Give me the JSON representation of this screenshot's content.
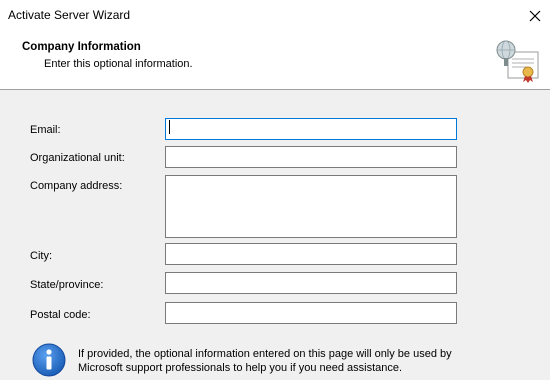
{
  "window": {
    "title": "Activate Server Wizard"
  },
  "header": {
    "title": "Company Information",
    "subtitle": "Enter this optional information."
  },
  "form": {
    "email_label": "Email:",
    "email_value": "",
    "org_unit_label": "Organizational unit:",
    "org_unit_value": "",
    "company_address_label": "Company address:",
    "company_address_value": "",
    "city_label": "City:",
    "city_value": "",
    "state_label": "State/province:",
    "state_value": "",
    "postal_label": "Postal code:",
    "postal_value": ""
  },
  "info": {
    "line1": "If provided, the optional information entered on this page will only be used by",
    "line2": "Microsoft support professionals to help you if you need assistance."
  },
  "icons": {
    "close": "close-icon",
    "header": "certificate-icon",
    "info": "information-icon"
  },
  "colors": {
    "accent": "#0078d7",
    "info_blue": "#1c5fb8"
  }
}
